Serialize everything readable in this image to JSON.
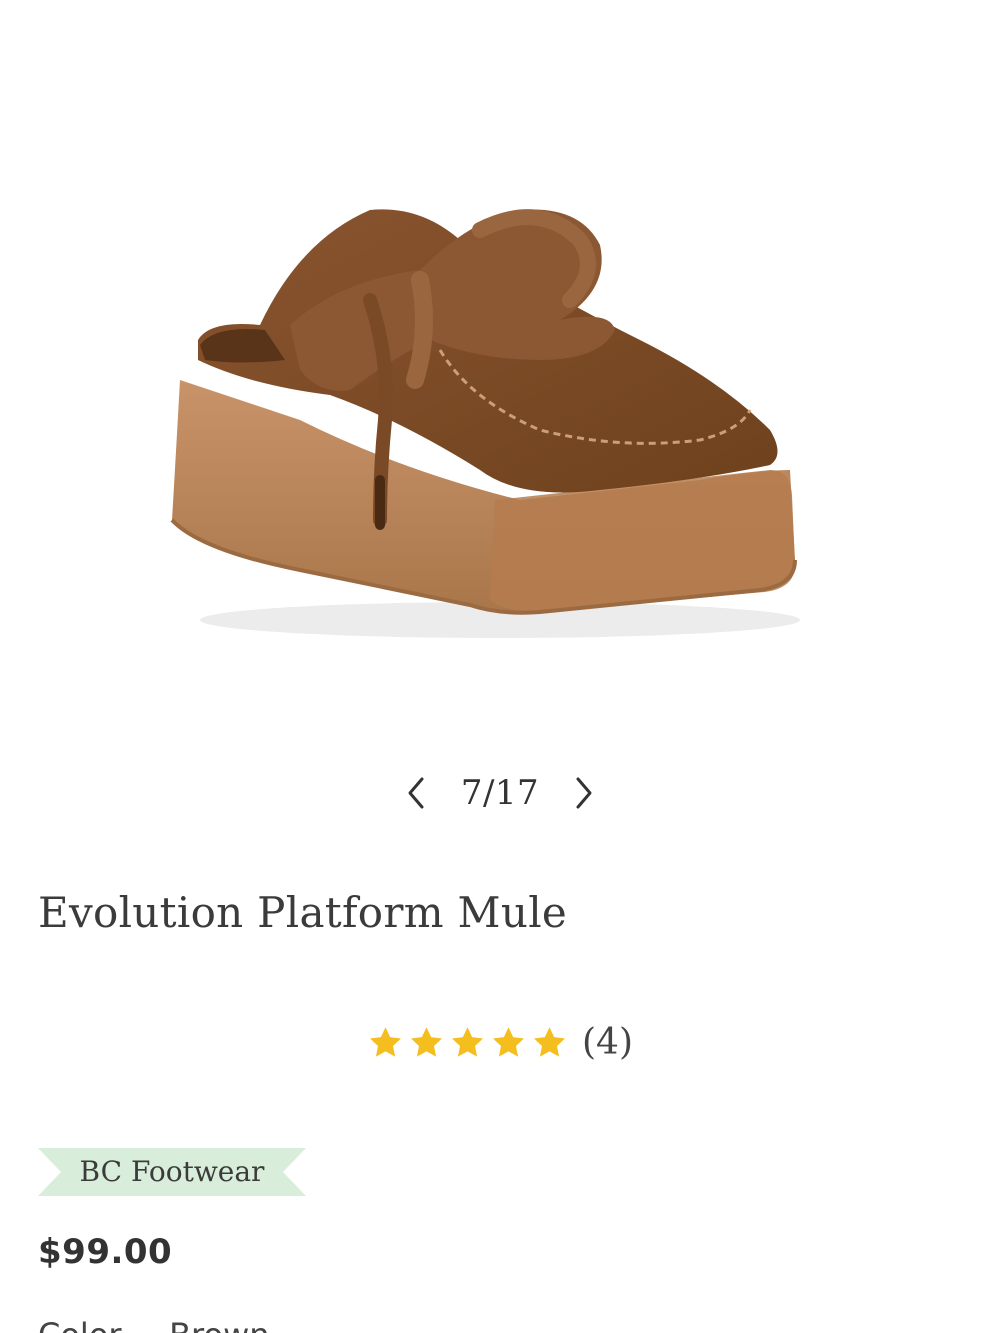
{
  "gallery": {
    "current": "7",
    "total": "17",
    "counter_text": "7/17",
    "prev_icon": "chevron-left-icon",
    "next_icon": "chevron-right-icon"
  },
  "product": {
    "title": "Evolution Platform Mule",
    "rating_value": 5,
    "rating_max": 5,
    "review_count_text": "(4)",
    "brand": "BC Footwear",
    "price": "$99.00",
    "color_label": "Color",
    "color_separator": "-",
    "color_value": "Brown"
  },
  "colors": {
    "star": "#F5BE1F",
    "brand_tag": "#D8EDDA",
    "text": "#3a3a3a",
    "shoe_upper": "#7B4A24",
    "shoe_sole": "#B98458"
  }
}
